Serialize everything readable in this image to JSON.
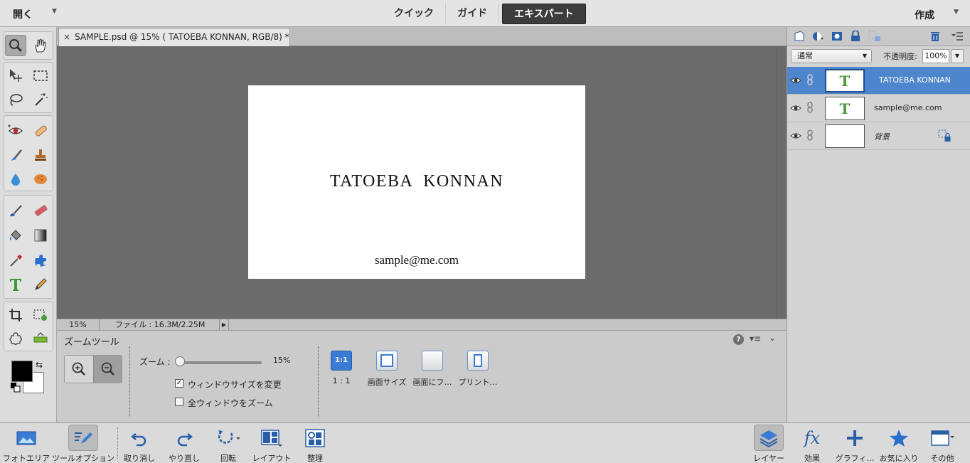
{
  "topbar": {
    "open_label": "開く",
    "modes": [
      "クイック",
      "ガイド",
      "エキスパート"
    ],
    "active_mode": "エキスパート",
    "create_label": "作成"
  },
  "document": {
    "tab_title": "SAMPLE.psd @ 15% (  TATOEBA  KONNAN, RGB/8) *",
    "close_glyph": "×",
    "canvas_title": "TATOEBA  KONNAN",
    "canvas_email": "sample@me.com"
  },
  "statusbar": {
    "zoom": "15%",
    "file_info": "ファイル : 16.3M/2.25M"
  },
  "tool_options": {
    "title": "ズームツール",
    "zoom_label": "ズーム :",
    "zoom_value": "15%",
    "zoom_level": 0.15,
    "checkbox_resize_label": "ウィンドウサイズを変更",
    "checkbox_resize_checked": true,
    "checkbox_all_label": "全ウィンドウをズーム",
    "checkbox_all_checked": false,
    "view_buttons": [
      "1 : 1",
      "画面サイズ",
      "画面にフ…",
      "プリント…"
    ],
    "one_to_one_icon_text": "1:1"
  },
  "layers_panel": {
    "blend_mode": "通常",
    "opacity_label": "不透明度:",
    "opacity_value": "100%",
    "layers": [
      {
        "name": "TATOEBA  KONNAN",
        "thumb": "T",
        "selected": true
      },
      {
        "name": "sample@me.com",
        "thumb": "T",
        "selected": false
      },
      {
        "name": "背景",
        "thumb": "",
        "selected": false,
        "locked": true
      }
    ]
  },
  "bottombar": {
    "left": [
      "フォトエリア",
      "ツールオプション",
      "取り消し",
      "やり直し",
      "回転",
      "レイアウト",
      "整理"
    ],
    "right": [
      "レイヤー",
      "効果",
      "グラフィ…",
      "お気に入り",
      "その他"
    ]
  },
  "colors": {
    "accent": "#4d86cc",
    "foreground_color": "#000000",
    "background_color": "#ffffff"
  }
}
